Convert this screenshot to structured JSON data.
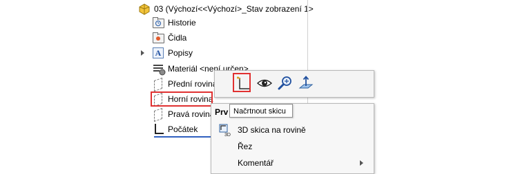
{
  "tree": {
    "part_title": "03  (Výchozí<<Výchozí>_Stav zobrazení 1>",
    "items": [
      {
        "label": "Historie",
        "icon": "history-folder-icon"
      },
      {
        "label": "Čidla",
        "icon": "sensors-folder-icon"
      },
      {
        "label": "Popisy",
        "icon": "annotations-icon"
      },
      {
        "label": "Materiál <není určen>",
        "icon": "material-icon"
      },
      {
        "label": "Přední rovina",
        "icon": "plane-icon"
      },
      {
        "label": "Horní rovina",
        "icon": "plane-icon"
      },
      {
        "label": "Pravá rovina",
        "icon": "plane-icon"
      },
      {
        "label": "Počátek",
        "icon": "origin-icon"
      }
    ]
  },
  "context_toolbar": {
    "buttons": [
      {
        "name": "sketch-icon"
      },
      {
        "name": "eye-icon"
      },
      {
        "name": "zoom-to-selection-icon"
      },
      {
        "name": "normal-to-icon"
      }
    ]
  },
  "tooltip": {
    "text": "Načrtnout skicu"
  },
  "menu": {
    "header": "Prv",
    "items": [
      {
        "label": "3D skica na rovině"
      },
      {
        "label": "Řez"
      },
      {
        "label": "Komentář"
      }
    ]
  },
  "colors": {
    "highlight": "#e03030",
    "selection_line": "#2f5fbf"
  }
}
